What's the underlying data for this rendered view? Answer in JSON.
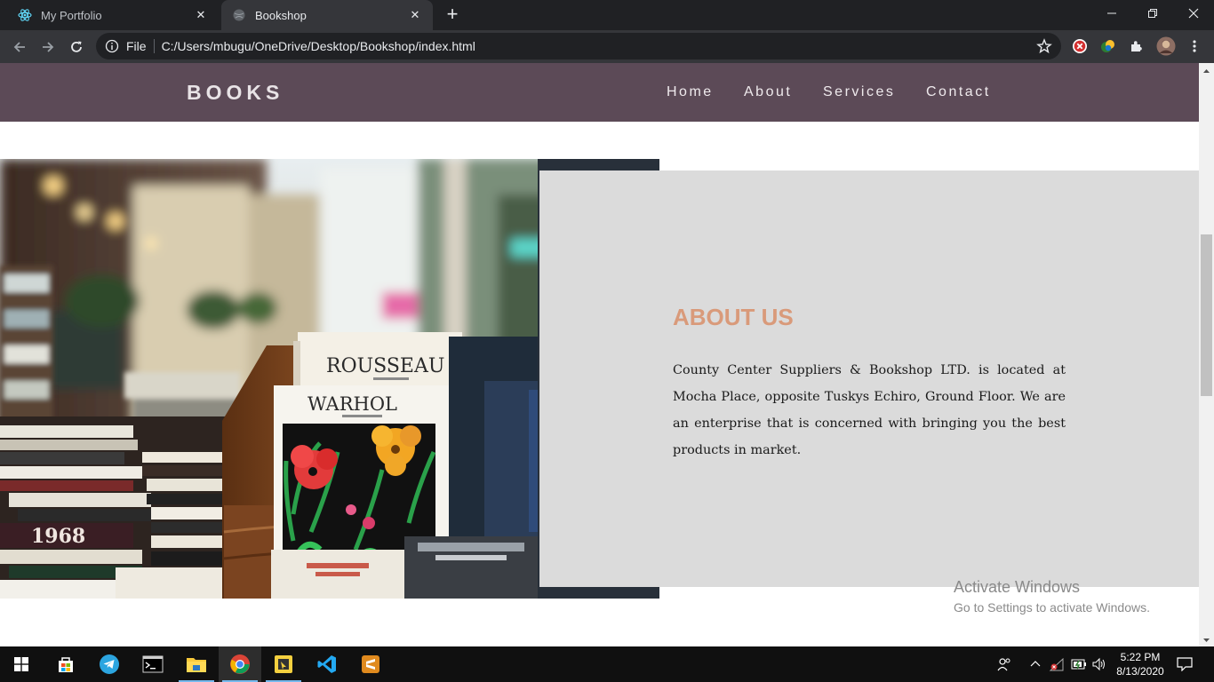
{
  "browser": {
    "tabs": [
      {
        "title": "My Portfolio"
      },
      {
        "title": "Bookshop"
      }
    ],
    "omnibox": {
      "scheme_label": "File",
      "url": "C:/Users/mbugu/OneDrive/Desktop/Bookshop/index.html"
    }
  },
  "site": {
    "logo": "BOOKS",
    "menu": [
      "Home",
      "About",
      "Services",
      "Contact"
    ],
    "about": {
      "title": "ABOUT US",
      "text": "County Center Suppliers & Bookshop LTD. is located at Mocha Place, opposite Tuskys Echiro, Ground Floor. We are an enterprise that is concerned with bringing you the best products in market."
    },
    "photo": {
      "book_1": "ROUSSEAU",
      "book_2": "WARHOL",
      "book_3": "1968"
    }
  },
  "watermark": {
    "line1": "Activate Windows",
    "line2": "Go to Settings to activate Windows."
  },
  "taskbar": {
    "time": "5:22 PM",
    "date": "8/13/2020"
  },
  "colors": {
    "nav_bg": "#5c4a57",
    "about_bg": "#dbdbdb",
    "about_title": "#d99a7a"
  }
}
